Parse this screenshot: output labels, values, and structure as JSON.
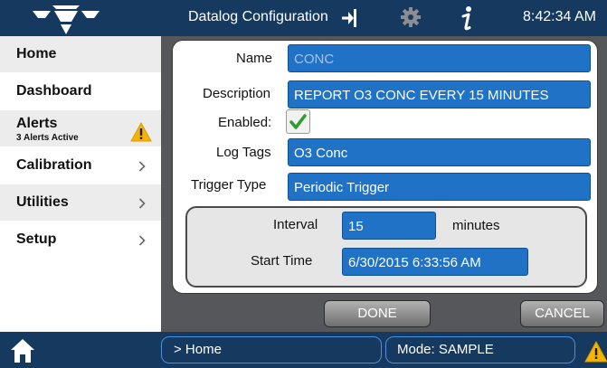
{
  "header": {
    "title": "Datalog Configuration",
    "time": "8:42:34 AM",
    "icons": [
      "logo-icon",
      "exit-icon",
      "gear-icon",
      "info-icon"
    ]
  },
  "sidebar": {
    "items": [
      {
        "label": "Home"
      },
      {
        "label": "Dashboard"
      },
      {
        "label": "Alerts",
        "sublabel": "3 Alerts Active"
      },
      {
        "label": "Calibration"
      },
      {
        "label": "Utilities"
      },
      {
        "label": "Setup"
      }
    ]
  },
  "form": {
    "name_label": "Name",
    "name_value": "CONC",
    "description_label": "Description",
    "description_value": "REPORT O3 CONC EVERY 15 MINUTES",
    "enabled_label": "Enabled:",
    "enabled_checked": true,
    "log_tags_label": "Log Tags",
    "log_tags_value": "O3 Conc",
    "trigger_type_label": "Trigger Type",
    "trigger_type_value": "Periodic Trigger",
    "interval_label": "Interval",
    "interval_value": "15",
    "interval_unit": "minutes",
    "start_time_label": "Start Time",
    "start_time_value": "6/30/2015 6:33:56 AM"
  },
  "buttons": {
    "done": "DONE",
    "cancel": "CANCEL"
  },
  "footer": {
    "breadcrumb": "> Home",
    "mode": "Mode: SAMPLE"
  },
  "colors": {
    "header_bg": "#15395f",
    "field_bg": "#1f72c6",
    "main_bg": "#56575a",
    "warning": "#f6b400",
    "check": "#2e9e2e"
  }
}
